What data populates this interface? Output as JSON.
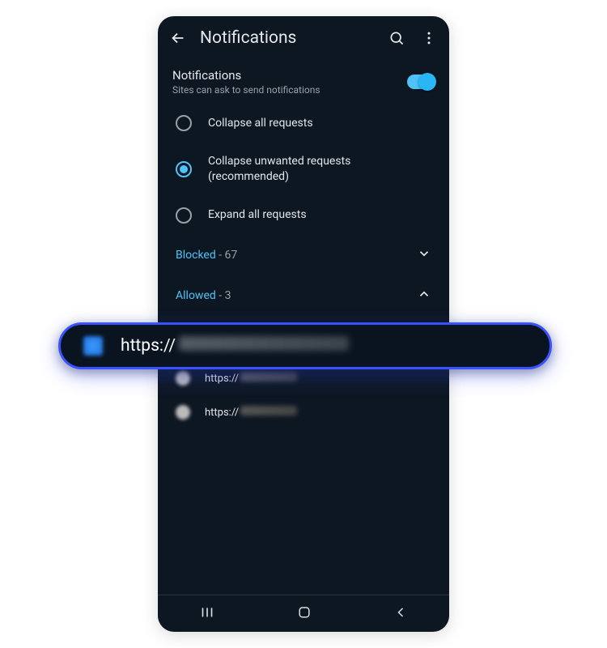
{
  "header": {
    "title": "Notifications"
  },
  "setting": {
    "title": "Notifications",
    "subtitle": "Sites can ask to send notifications",
    "enabled": true
  },
  "options": [
    {
      "label": "Collapse all requests",
      "selected": false
    },
    {
      "label": "Collapse unwanted requests (recommended)",
      "selected": true
    },
    {
      "label": "Expand all requests",
      "selected": false
    }
  ],
  "sections": {
    "blocked": {
      "label": "Blocked",
      "count": 67,
      "expanded": false
    },
    "allowed": {
      "label": "Allowed",
      "count": 3,
      "expanded": true
    }
  },
  "allowed_sites": [
    {
      "prefix": "https://"
    },
    {
      "prefix": "https://"
    },
    {
      "prefix": "https://"
    }
  ],
  "highlight": {
    "prefix": "https://"
  },
  "colors": {
    "accent": "#4fc3f7",
    "highlight_border": "#3a52ff",
    "bg": "#0d1722"
  }
}
